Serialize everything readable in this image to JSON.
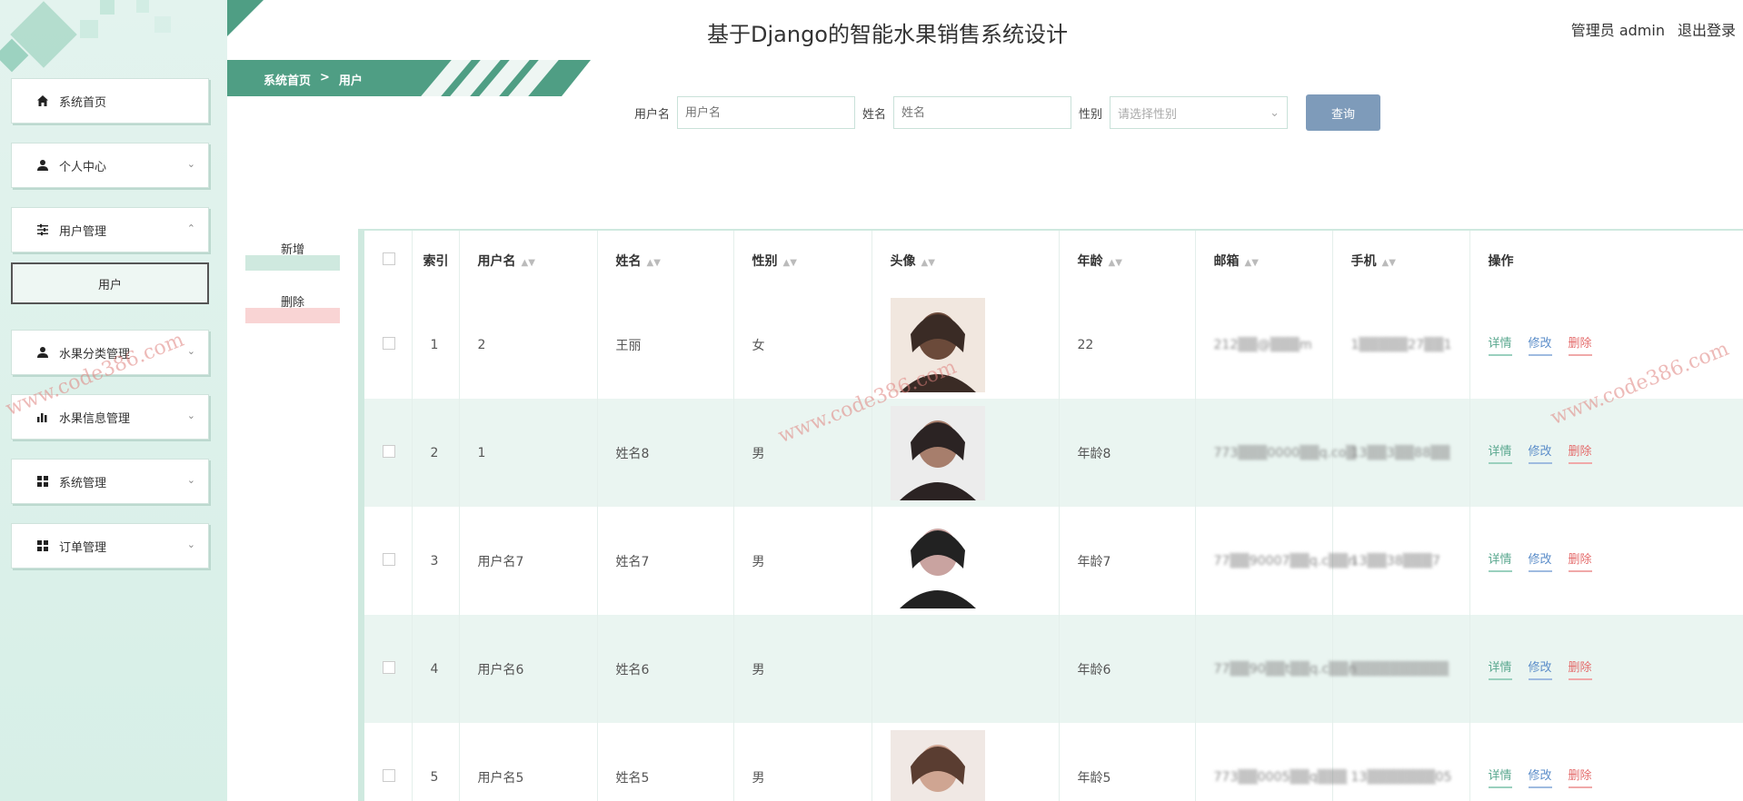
{
  "header": {
    "title": "基于Django的智能水果销售系统设计",
    "role_user": "管理员 admin",
    "logout": "退出登录"
  },
  "sidebar": {
    "items": [
      {
        "label": "系统首页",
        "icon": "home-icon",
        "expanded": false
      },
      {
        "label": "个人中心",
        "icon": "user-icon",
        "expanded": false
      },
      {
        "label": "用户管理",
        "icon": "sliders-icon",
        "expanded": true
      },
      {
        "label": "水果分类管理",
        "icon": "user-icon",
        "expanded": false
      },
      {
        "label": "水果信息管理",
        "icon": "bar-chart-icon",
        "expanded": false
      },
      {
        "label": "系统管理",
        "icon": "grid-icon",
        "expanded": false
      },
      {
        "label": "订单管理",
        "icon": "grid-icon",
        "expanded": false
      }
    ],
    "sub_item": "用户"
  },
  "breadcrumb": {
    "home": "系统首页",
    "sep": ">",
    "current": "用户"
  },
  "search": {
    "username_label": "用户名",
    "username_placeholder": "用户名",
    "name_label": "姓名",
    "name_placeholder": "姓名",
    "gender_label": "性别",
    "gender_placeholder": "请选择性别",
    "query_button": "查询"
  },
  "actions": {
    "add": "新增",
    "delete": "删除"
  },
  "table": {
    "columns": [
      "索引",
      "用户名",
      "姓名",
      "性别",
      "头像",
      "年龄",
      "邮箱",
      "手机",
      "操作"
    ],
    "rows": [
      {
        "index": "1",
        "username": "2",
        "name": "王丽",
        "gender": "女",
        "avatar": true,
        "age": "22",
        "email": "212▒▒@▒▒▒m",
        "phone": "1▒▒▒▒▒27▒▒1"
      },
      {
        "index": "2",
        "username": "1",
        "name": "姓名8",
        "gender": "男",
        "avatar": true,
        "age": "年龄8",
        "email": "773▒▒▒0000▒▒q.co▒",
        "phone": "13▒▒3▒▒88▒▒"
      },
      {
        "index": "3",
        "username": "用户名7",
        "name": "姓名7",
        "gender": "男",
        "avatar": true,
        "age": "年龄7",
        "email": "77▒▒90007▒▒q.c▒▒n",
        "phone": "13▒▒38▒▒▒7"
      },
      {
        "index": "4",
        "username": "用户名6",
        "name": "姓名6",
        "gender": "男",
        "avatar": false,
        "age": "年龄6",
        "email": "77▒▒90▒▒t▒▒q.c▒▒n",
        "phone": "▒▒▒▒▒▒▒▒▒▒"
      },
      {
        "index": "5",
        "username": "用户名5",
        "name": "姓名5",
        "gender": "男",
        "avatar": true,
        "age": "年龄5",
        "email": "773▒▒0005▒▒q▒▒▒",
        "phone": "13▒▒▒▒▒▒▒05"
      }
    ],
    "ops": {
      "detail": "详情",
      "edit": "修改",
      "remove": "删除"
    }
  },
  "watermark": "www.code386.com",
  "colors": {
    "accent": "#4f9e84",
    "sidebar_bg": "#e3f3ee",
    "row_alt": "#eaf5f1",
    "query_button": "#7e9bba"
  }
}
